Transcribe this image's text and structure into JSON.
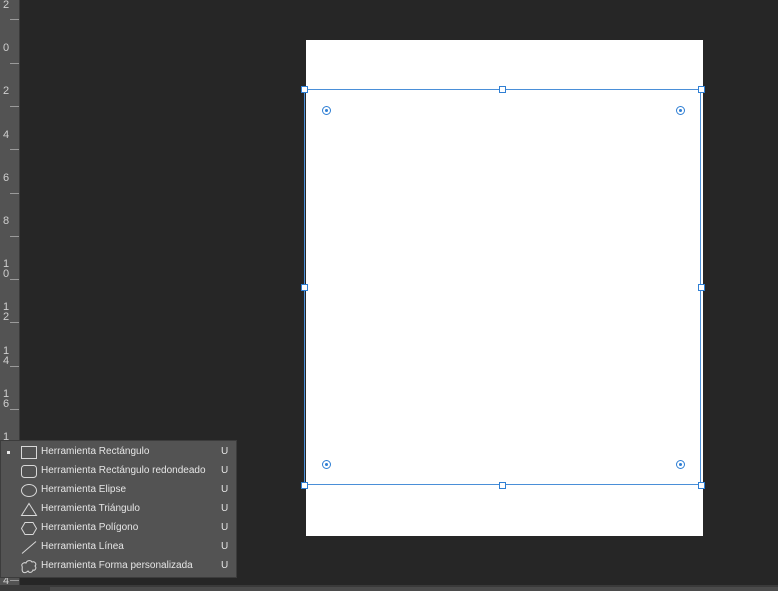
{
  "ruler": {
    "labels": [
      {
        "lines": [
          "2"
        ]
      },
      {
        "lines": [
          "0"
        ]
      },
      {
        "lines": [
          "2"
        ]
      },
      {
        "lines": [
          "4"
        ]
      },
      {
        "lines": [
          "6"
        ]
      },
      {
        "lines": [
          "8"
        ]
      },
      {
        "lines": [
          "1",
          "0"
        ]
      },
      {
        "lines": [
          "1",
          "2"
        ]
      },
      {
        "lines": [
          "1",
          "4"
        ]
      },
      {
        "lines": [
          "1",
          "6"
        ]
      },
      {
        "lines": [
          "1"
        ]
      },
      {
        "lines": [
          "4"
        ]
      }
    ]
  },
  "flyout": {
    "items": [
      {
        "label": "Herramienta Rectángulo",
        "key": "U",
        "icon": "rectangle-icon",
        "selected": true
      },
      {
        "label": "Herramienta Rectángulo redondeado",
        "key": "U",
        "icon": "rounded-rectangle-icon",
        "selected": false
      },
      {
        "label": "Herramienta Elipse",
        "key": "U",
        "icon": "ellipse-icon",
        "selected": false
      },
      {
        "label": "Herramienta Triángulo",
        "key": "U",
        "icon": "triangle-icon",
        "selected": false
      },
      {
        "label": "Herramienta Polígono",
        "key": "U",
        "icon": "polygon-icon",
        "selected": false
      },
      {
        "label": "Herramienta Línea",
        "key": "U",
        "icon": "line-icon",
        "selected": false
      },
      {
        "label": "Herramienta Forma personalizada",
        "key": "U",
        "icon": "custom-shape-icon",
        "selected": false
      }
    ]
  },
  "colors": {
    "workspace": "#262626",
    "panel": "#535353",
    "selection": "#2f7fd4",
    "canvas": "#ffffff"
  }
}
